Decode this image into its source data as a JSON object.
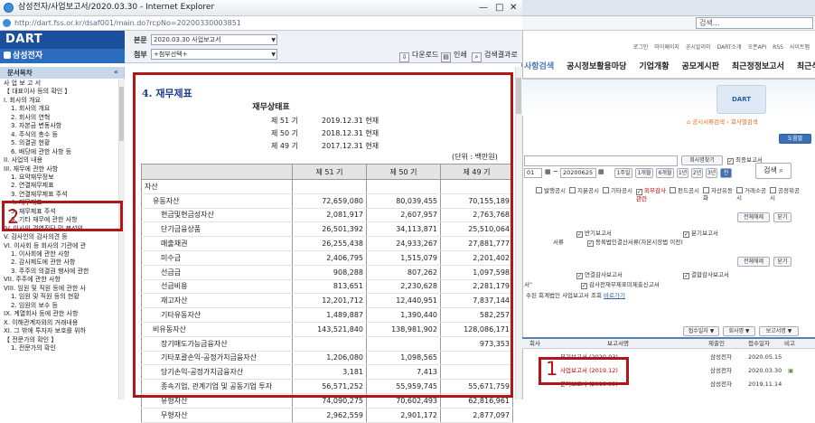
{
  "background": {
    "search_placeholder": "검색...",
    "top_links": [
      "로그인",
      "마이페이지",
      "공시알리미",
      "DART소개",
      "오픈API",
      "RSS",
      "사이트맵"
    ],
    "nav": [
      "사항검색",
      "공시정보활용마당",
      "기업개황",
      "공모게시판",
      "최근정정보고서",
      "최근삭제보고서"
    ],
    "breadcrumb": "공시서류검색 › 회사별검색",
    "help_button": "도움말",
    "report_name_button": "회사명찾기",
    "last_report_checkbox": "최종보고서",
    "date_from": "01",
    "date_to": "20200625",
    "period_buttons": [
      "1주일",
      "1개월",
      "6개월",
      "1년",
      "2년",
      "3년",
      "전체"
    ],
    "search_button": "검색",
    "categories": [
      "발행공시",
      "지분공시",
      "기타공시",
      "외부감사관련",
      "펀드공시",
      "자산유동화",
      "거래소공시",
      "공정위공시"
    ],
    "select_all": "전체해제",
    "close": "닫기",
    "options_row1": [
      "반기보고서",
      "분기보고서"
    ],
    "options_row2": "등록법인결산서류(자본시장법 이전)",
    "options_row3": [
      "연결감사보고서",
      "결합감사보고서"
    ],
    "options_row4": "감사전재무제표미제출신고서",
    "options_row5": "수된 회계법인 사업보고서 조회",
    "options_row5_link": "바로가기",
    "sort_receipt": "접수일자",
    "sort_company": "회사명",
    "sort_report": "보고서명",
    "result_header": [
      "보고서명",
      "제출인",
      "접수일자",
      "비고"
    ],
    "result_left_header": "회사",
    "results": [
      {
        "name": "분기보고서 (2020.03)",
        "submitter": "삼성전자",
        "date": "2020.05.15",
        "highlight": false
      },
      {
        "name": "사업보고서 (2019.12)",
        "submitter": "삼성전자",
        "date": "2020.03.30",
        "highlight": true
      },
      {
        "name": "분기보고서 (2019.09)",
        "submitter": "삼성전자",
        "date": "2019.11.14",
        "highlight": false
      }
    ]
  },
  "window": {
    "title": "삼성전자/사업보고서/2020.03.30 - Internet Explorer",
    "url": "http://dart.fss.or.kr/dsaf001/main.do?rcpNo=20200330003851",
    "logo": "DART",
    "company": "삼성전자",
    "body_label": "본문",
    "body_value": "2020.03.30  사업보고서",
    "attach_label": "첨부",
    "attach_value": "+첨부선택+",
    "download": "다운로드",
    "print": "인쇄",
    "search_results": "검색결과로"
  },
  "sidebar": {
    "title": "문서목차",
    "items": [
      {
        "label": "사 업 보 고 서",
        "indent": 0
      },
      {
        "label": "【 대표이사 등의 확인 】",
        "indent": 0
      },
      {
        "label": "I. 회사의 개요",
        "indent": 0
      },
      {
        "label": "1. 회사의 개요",
        "indent": 1
      },
      {
        "label": "2. 회사의 연혁",
        "indent": 1
      },
      {
        "label": "3. 자본금 변동사항",
        "indent": 1
      },
      {
        "label": "4. 주식의 총수 등",
        "indent": 1
      },
      {
        "label": "5. 의결권 현황",
        "indent": 1
      },
      {
        "label": "6. 배당에 관한 사항 등",
        "indent": 1
      },
      {
        "label": "II. 사업의 내용",
        "indent": 0
      },
      {
        "label": "III. 재무에 관한 사항",
        "indent": 0
      },
      {
        "label": "1. 요약재무정보",
        "indent": 1
      },
      {
        "label": "2. 연결재무제표",
        "indent": 1
      },
      {
        "label": "3. 연결재무제표 주석",
        "indent": 1
      },
      {
        "label": "4. 재무제표",
        "indent": 1
      },
      {
        "label": "5. 재무제표 주석",
        "indent": 1
      },
      {
        "label": "6. 기타 재무에 관한 사항",
        "indent": 1
      },
      {
        "label": "IV. 이사의 경영진단 및 분석의",
        "indent": 0
      },
      {
        "label": "V. 감사인의 감사의견 등",
        "indent": 0
      },
      {
        "label": "VI. 이사회 등 회사의 기관에 관",
        "indent": 0
      },
      {
        "label": "1. 이사회에 관한 사항",
        "indent": 1
      },
      {
        "label": "2. 감사제도에 관한 사항",
        "indent": 1
      },
      {
        "label": "3. 주주의 의결권 행사에 관한",
        "indent": 1
      },
      {
        "label": "VII. 주주에 관한 사항",
        "indent": 0
      },
      {
        "label": "VIII. 임원 및 직원 등에 관한 사",
        "indent": 0
      },
      {
        "label": "1. 임원 및 직원 등의 현황",
        "indent": 1
      },
      {
        "label": "2. 임원의 보수 등",
        "indent": 1
      },
      {
        "label": "IX. 계열회사 등에 관한 사항",
        "indent": 0
      },
      {
        "label": "X. 이해관계자와의 거래내용",
        "indent": 0
      },
      {
        "label": "XI. 그 밖에 투자자 보호를 위하",
        "indent": 0
      },
      {
        "label": "【 전문가의 확인 】",
        "indent": 0
      },
      {
        "label": "1. 전문가의 확인",
        "indent": 1
      }
    ]
  },
  "document": {
    "section_title": "4. 재무제표",
    "title": "재무상태표",
    "periods": [
      {
        "label": "제 51 기",
        "date": "2019.12.31 현재"
      },
      {
        "label": "제 50 기",
        "date": "2018.12.31 현재"
      },
      {
        "label": "제 49 기",
        "date": "2017.12.31 현재"
      }
    ],
    "unit": "(단위 : 백만원)",
    "columns": [
      "",
      "제 51 기",
      "제 50 기",
      "제 49 기"
    ],
    "rows": [
      {
        "label": "자산",
        "indent": 0,
        "v": [
          "",
          "",
          ""
        ]
      },
      {
        "label": "유동자산",
        "indent": 1,
        "v": [
          "72,659,080",
          "80,039,455",
          "70,155,189"
        ]
      },
      {
        "label": "현금및현금성자산",
        "indent": 2,
        "v": [
          "2,081,917",
          "2,607,957",
          "2,763,768"
        ]
      },
      {
        "label": "단기금융상품",
        "indent": 2,
        "v": [
          "26,501,392",
          "34,113,871",
          "25,510,064"
        ]
      },
      {
        "label": "매출채권",
        "indent": 2,
        "v": [
          "26,255,438",
          "24,933,267",
          "27,881,777"
        ]
      },
      {
        "label": "미수금",
        "indent": 2,
        "v": [
          "2,406,795",
          "1,515,079",
          "2,201,402"
        ]
      },
      {
        "label": "선급금",
        "indent": 2,
        "v": [
          "908,288",
          "807,262",
          "1,097,598"
        ]
      },
      {
        "label": "선급비용",
        "indent": 2,
        "v": [
          "813,651",
          "2,230,628",
          "2,281,179"
        ]
      },
      {
        "label": "재고자산",
        "indent": 2,
        "v": [
          "12,201,712",
          "12,440,951",
          "7,837,144"
        ]
      },
      {
        "label": "기타유동자산",
        "indent": 2,
        "v": [
          "1,489,887",
          "1,390,440",
          "582,257"
        ]
      },
      {
        "label": "비유동자산",
        "indent": 1,
        "v": [
          "143,521,840",
          "138,981,902",
          "128,086,171"
        ]
      },
      {
        "label": "장기매도가능금융자산",
        "indent": 2,
        "v": [
          "",
          "",
          "973,353"
        ]
      },
      {
        "label": "기타포괄손익-공정가치금융자산",
        "indent": 2,
        "v": [
          "1,206,080",
          "1,098,565",
          ""
        ]
      },
      {
        "label": "당기손익-공정가치금융자산",
        "indent": 2,
        "v": [
          "3,181",
          "7,413",
          ""
        ]
      },
      {
        "label": "종속기업, 관계기업 및 공동기업 투자",
        "indent": 2,
        "v": [
          "56,571,252",
          "55,959,745",
          "55,671,759"
        ]
      },
      {
        "label": "유형자산",
        "indent": 2,
        "v": [
          "74,090,275",
          "70,602,493",
          "62,816,961"
        ]
      },
      {
        "label": "무형자산",
        "indent": 2,
        "v": [
          "2,962,559",
          "2,901,172",
          "2,877,097"
        ]
      }
    ]
  },
  "annotations": {
    "one": "1",
    "two": "2"
  }
}
